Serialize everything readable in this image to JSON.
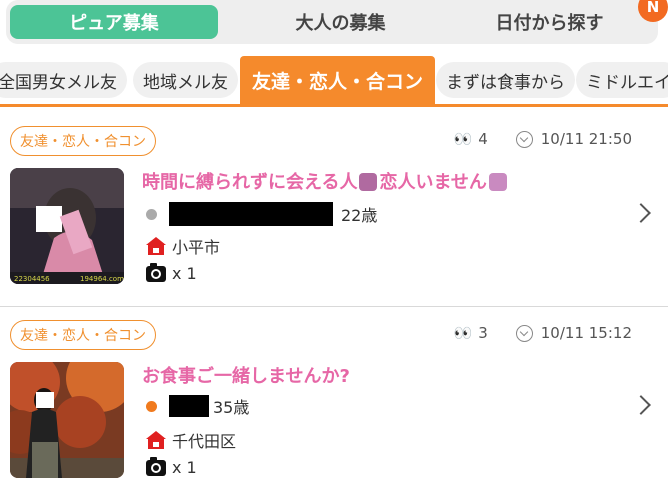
{
  "tabs": [
    {
      "label": "ピュア募集",
      "active": true
    },
    {
      "label": "大人の募集",
      "active": false
    },
    {
      "label": "日付から探す",
      "active": false
    }
  ],
  "notification_badge": "N",
  "categories": [
    {
      "label": "全国男女メル友",
      "active": false
    },
    {
      "label": "地域メル友",
      "active": false
    },
    {
      "label": "友達・恋人・合コン",
      "active": true
    },
    {
      "label": "まずは食事から",
      "active": false
    },
    {
      "label": "ミドルエイ",
      "active": false
    }
  ],
  "posts": [
    {
      "category_tag": "友達・恋人・合コン",
      "views": "4",
      "datetime": "10/11 21:50",
      "title_part1": "時間に縛られずに会える人",
      "title_part2": "恋人いません",
      "age": "22歳",
      "location": "小平市",
      "photo_count": "x 1",
      "status_color": "#aaaaaa"
    },
    {
      "category_tag": "友達・恋人・合コン",
      "views": "3",
      "datetime": "10/11 15:12",
      "title": "お食事ご一緒しませんか?",
      "age": "35歳",
      "location": "千代田区",
      "photo_count": "x 1",
      "status_color": "#f07a1e"
    }
  ],
  "colors": {
    "accent_green": "#4cc496",
    "accent_orange": "#f58a2c",
    "title_pink": "#e667a6",
    "home_red": "#e02020"
  }
}
